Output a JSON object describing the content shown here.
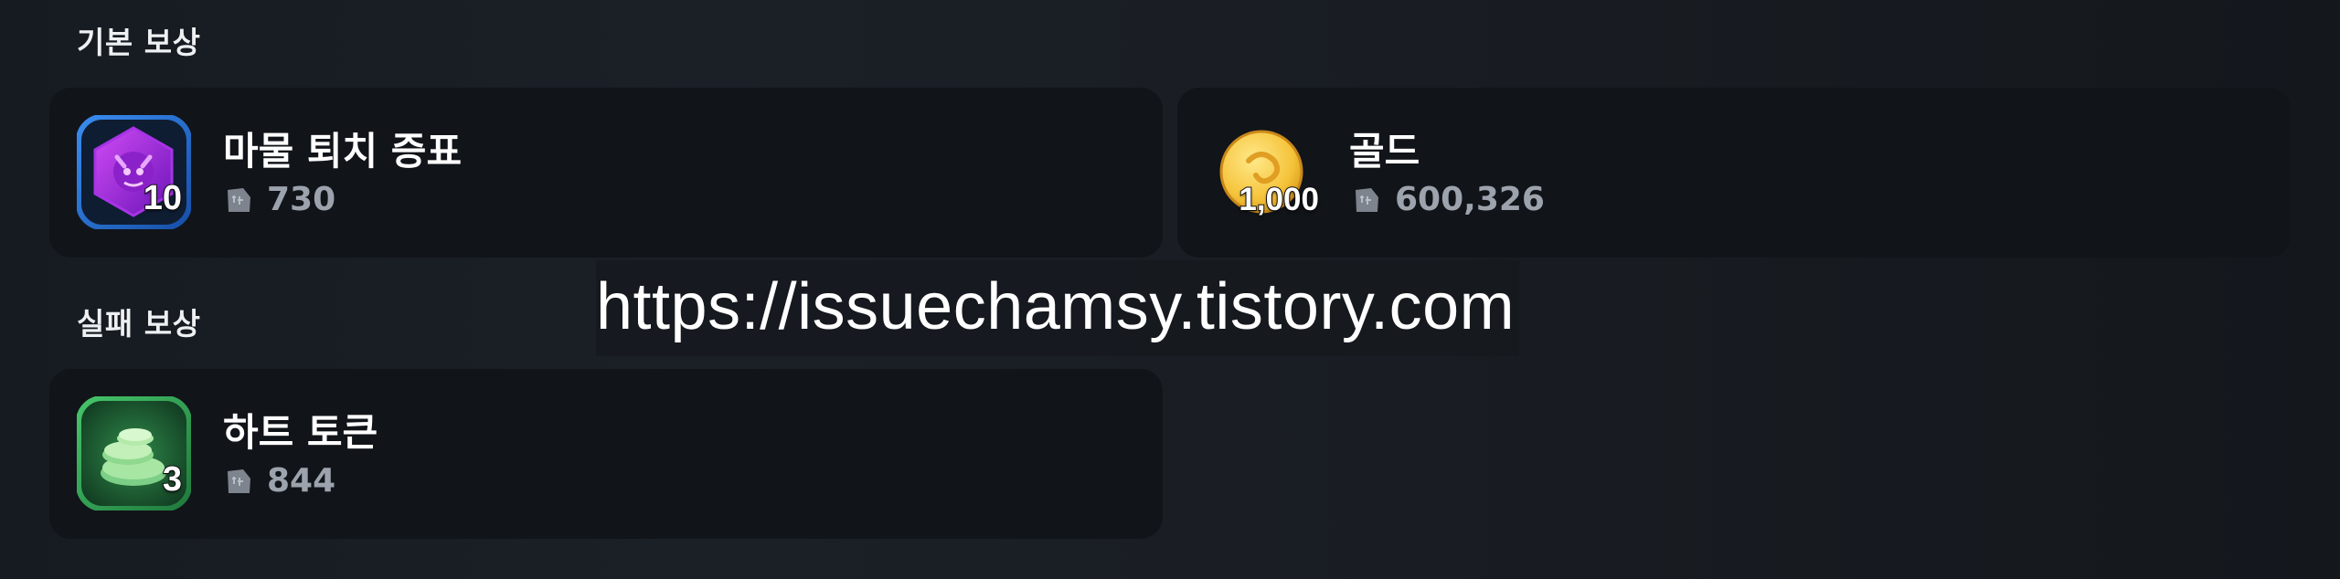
{
  "sections": {
    "basic": {
      "title": "기본 보상",
      "items": [
        {
          "name": "마물 퇴치 증표",
          "quantity": "10",
          "price": "730",
          "icon": "monster-badge-icon",
          "frame_color": "#1f6fd1"
        },
        {
          "name": "골드",
          "quantity": "1,000",
          "price": "600,326",
          "icon": "gold-coin-icon"
        }
      ]
    },
    "failure": {
      "title": "실패 보상",
      "items": [
        {
          "name": "하트 토큰",
          "quantity": "3",
          "price": "844",
          "icon": "heart-token-icon",
          "frame_color": "#2f9e4f"
        }
      ]
    }
  },
  "watermark": "https://issuechamsy.tistory.com",
  "price_icon": "price-tag-icon"
}
